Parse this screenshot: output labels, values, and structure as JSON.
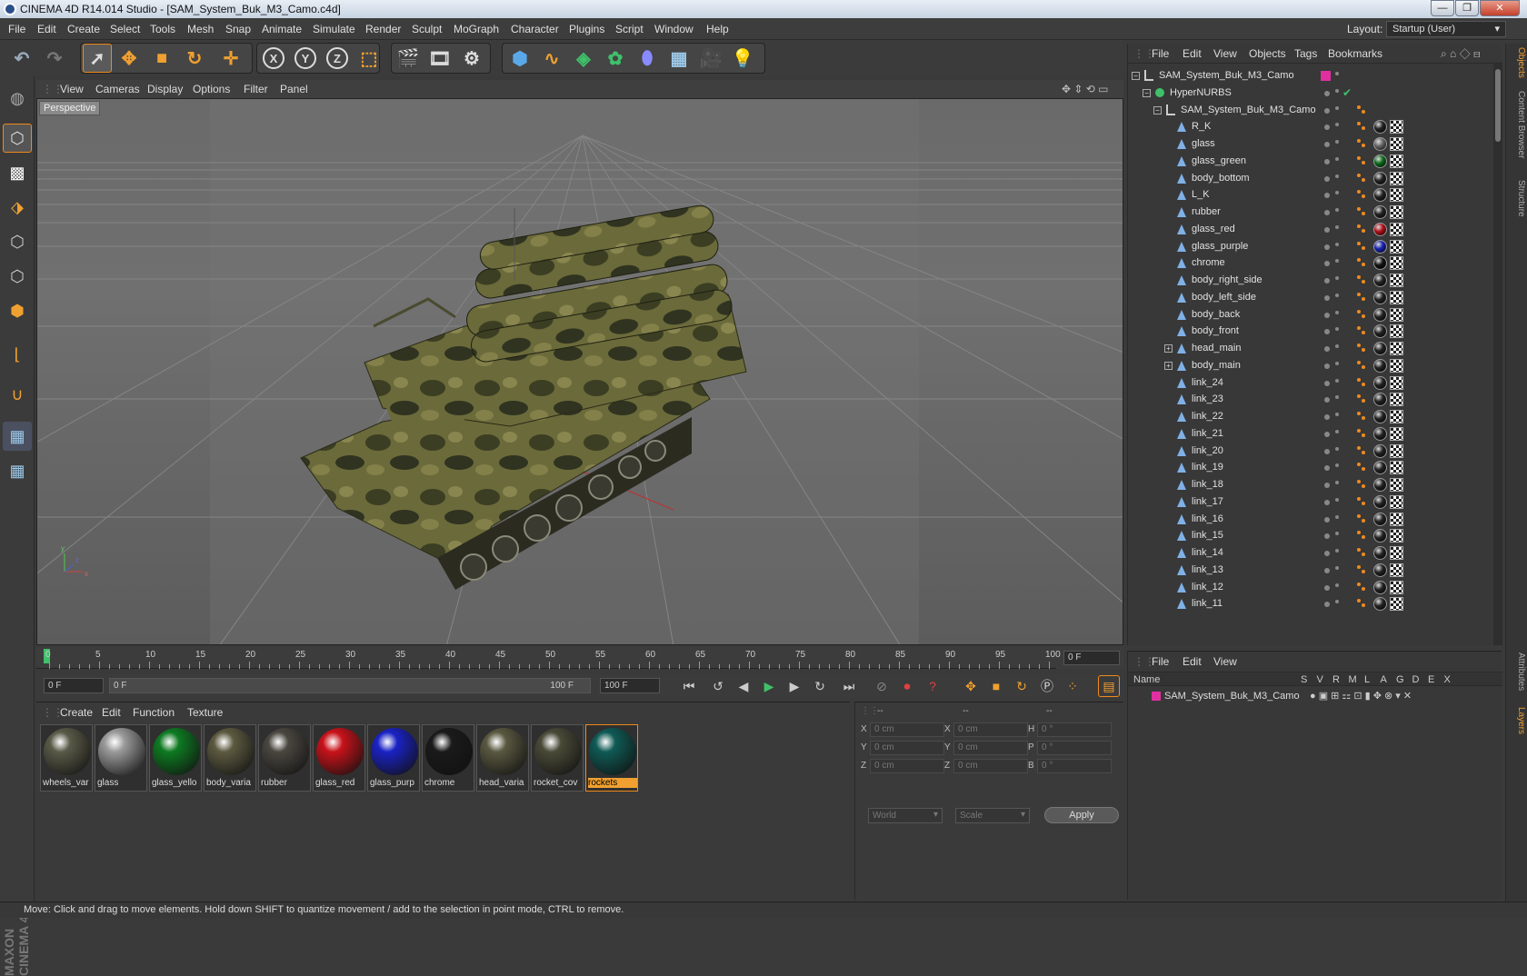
{
  "window": {
    "title": "CINEMA 4D R14.014 Studio - [SAM_System_Buk_M3_Camo.c4d]",
    "buttons": [
      "—",
      "❐",
      "✕"
    ]
  },
  "menu": [
    "File",
    "Edit",
    "Create",
    "Select",
    "Tools",
    "Mesh",
    "Snap",
    "Animate",
    "Simulate",
    "Render",
    "Sculpt",
    "MoGraph",
    "Character",
    "Plugins",
    "Script",
    "Window",
    "Help"
  ],
  "layout": {
    "label": "Layout:",
    "value": "Startup (User)"
  },
  "toolbar": {
    "undo": "↶",
    "redo": "↷",
    "axes": [
      "X",
      "Y",
      "Z"
    ]
  },
  "viewport": {
    "menu": [
      "View",
      "Cameras",
      "Display",
      "Options",
      "Filter",
      "Panel"
    ],
    "label": "Perspective"
  },
  "timeline": {
    "ticks": [
      "0",
      "5",
      "10",
      "15",
      "20",
      "25",
      "30",
      "35",
      "40",
      "45",
      "50",
      "55",
      "60",
      "65",
      "70",
      "75",
      "80",
      "85",
      "90",
      "95",
      "100"
    ],
    "frame": "0 F"
  },
  "anim": {
    "start": "0 F",
    "range_start": "0 F",
    "range_end": "100 F",
    "end": "100 F"
  },
  "materials": {
    "menu": [
      "Create",
      "Edit",
      "Function",
      "Texture"
    ],
    "items": [
      {
        "name": "wheels_var",
        "color": "#5a5a48"
      },
      {
        "name": "glass",
        "color": "#9a9a9a"
      },
      {
        "name": "glass_yello",
        "color": "#0e7a22"
      },
      {
        "name": "body_varia",
        "color": "#5d5a40"
      },
      {
        "name": "rubber",
        "color": "#4a4740"
      },
      {
        "name": "glass_red",
        "color": "#c8121a"
      },
      {
        "name": "glass_purp",
        "color": "#1a22c4"
      },
      {
        "name": "chrome",
        "color": "#1a1a1a"
      },
      {
        "name": "head_varia",
        "color": "#5a5840"
      },
      {
        "name": "rocket_cov",
        "color": "#4a4a38"
      },
      {
        "name": "rockets",
        "color": "#0f5a55",
        "selected": true
      }
    ]
  },
  "coords": {
    "header": [
      "--",
      "--",
      "--"
    ],
    "rows": [
      {
        "a": "X",
        "av": "0 cm",
        "b": "X",
        "bv": "0 cm",
        "c": "H",
        "cv": "0 °"
      },
      {
        "a": "Y",
        "av": "0 cm",
        "b": "Y",
        "bv": "0 cm",
        "c": "P",
        "cv": "0 °"
      },
      {
        "a": "Z",
        "av": "0 cm",
        "b": "Z",
        "bv": "0 cm",
        "c": "B",
        "cv": "0 °"
      }
    ],
    "mode": "World",
    "scale": "Scale",
    "apply": "Apply"
  },
  "objects": {
    "menu": [
      "File",
      "Edit",
      "View",
      "Objects",
      "Tags",
      "Bookmarks"
    ],
    "rows": [
      {
        "name": "SAM_System_Buk_M3_Camo",
        "indent": 0,
        "kind": "root"
      },
      {
        "name": "HyperNURBS",
        "indent": 1,
        "kind": "hn"
      },
      {
        "name": "SAM_System_Buk_M3_Camo",
        "indent": 2,
        "kind": "null"
      },
      {
        "name": "R_K",
        "indent": 3,
        "mat": "#222"
      },
      {
        "name": "glass",
        "indent": 3,
        "mat": "#666"
      },
      {
        "name": "glass_green",
        "indent": 3,
        "mat": "#0c6a1c"
      },
      {
        "name": "body_bottom",
        "indent": 3,
        "mat": "#222"
      },
      {
        "name": "L_K",
        "indent": 3,
        "mat": "#222"
      },
      {
        "name": "rubber",
        "indent": 3,
        "mat": "#222"
      },
      {
        "name": "glass_red",
        "indent": 3,
        "mat": "#b01018"
      },
      {
        "name": "glass_purple",
        "indent": 3,
        "mat": "#1822b0"
      },
      {
        "name": "chrome",
        "indent": 3,
        "mat": "#111"
      },
      {
        "name": "body_right_side",
        "indent": 3,
        "mat": "#222"
      },
      {
        "name": "body_left_side",
        "indent": 3,
        "mat": "#222"
      },
      {
        "name": "body_back",
        "indent": 3,
        "mat": "#222"
      },
      {
        "name": "body_front",
        "indent": 3,
        "mat": "#222"
      },
      {
        "name": "head_main",
        "indent": 3,
        "mat": "#222",
        "exp": true
      },
      {
        "name": "body_main",
        "indent": 3,
        "mat": "#222",
        "exp": true
      },
      {
        "name": "link_24",
        "indent": 3,
        "mat": "#222"
      },
      {
        "name": "link_23",
        "indent": 3,
        "mat": "#222"
      },
      {
        "name": "link_22",
        "indent": 3,
        "mat": "#222"
      },
      {
        "name": "link_21",
        "indent": 3,
        "mat": "#222"
      },
      {
        "name": "link_20",
        "indent": 3,
        "mat": "#222"
      },
      {
        "name": "link_19",
        "indent": 3,
        "mat": "#222"
      },
      {
        "name": "link_18",
        "indent": 3,
        "mat": "#222"
      },
      {
        "name": "link_17",
        "indent": 3,
        "mat": "#222"
      },
      {
        "name": "link_16",
        "indent": 3,
        "mat": "#222"
      },
      {
        "name": "link_15",
        "indent": 3,
        "mat": "#222"
      },
      {
        "name": "link_14",
        "indent": 3,
        "mat": "#222"
      },
      {
        "name": "link_13",
        "indent": 3,
        "mat": "#222"
      },
      {
        "name": "link_12",
        "indent": 3,
        "mat": "#222"
      },
      {
        "name": "link_11",
        "indent": 3,
        "mat": "#222"
      }
    ]
  },
  "layers": {
    "menu": [
      "File",
      "Edit",
      "View"
    ],
    "columns": [
      "Name",
      "S",
      "V",
      "R",
      "M",
      "L",
      "A",
      "G",
      "D",
      "E",
      "X"
    ],
    "row": "SAM_System_Buk_M3_Camo"
  },
  "side_tabs": [
    "Objects",
    "Content Browser",
    "Structure",
    "Attributes",
    "Layers"
  ],
  "status": "Move: Click and drag to move elements. Hold down SHIFT to quantize movement / add to the selection in point mode, CTRL to remove.",
  "brand": "MAXON CINEMA 4D"
}
